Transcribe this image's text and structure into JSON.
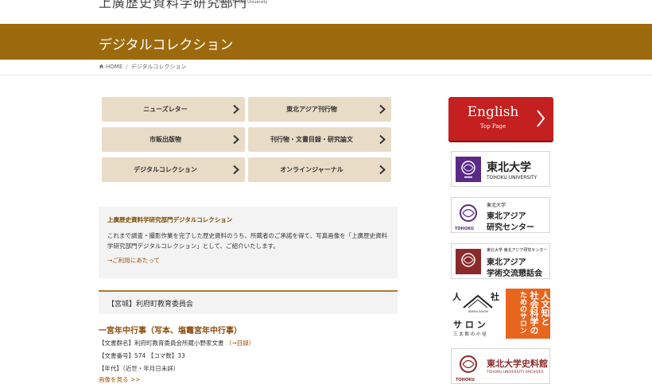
{
  "header": {
    "site_title": "上廣歴史資料学研究部門",
    "site_sub": "CNEAS, Tohoku University"
  },
  "banner": {
    "title": "デジタルコレクション"
  },
  "breadcrumb": {
    "home": "HOME",
    "current": "デジタルコレクション"
  },
  "nav": [
    {
      "label": "ニューズレター"
    },
    {
      "label": "東北アジア刊行物"
    },
    {
      "label": "市販出版物"
    },
    {
      "label": "刊行物・文書目録・研究論文"
    },
    {
      "label": "デジタルコレクション"
    },
    {
      "label": "オンラインジャーナル"
    }
  ],
  "info": {
    "title": "上廣歴史資料学研究部門デジタルコレクション",
    "text": "これまで調査・撮影作業を完了した歴史資料のうち、所蔵者のご承諾を得て、写真画像を「上廣歴史資料学研究部門デジタルコレクション」として、ご紹介いたします。",
    "link": "→ご利用にあたって"
  },
  "section": {
    "title": "【宮城】利府町教育委員会"
  },
  "item": {
    "title": "一宮年中行事（写本、塩竈宮年中行事）",
    "doc_group": "【文書群名】利府町教育委員会所蔵小野家文書",
    "doc_group_link": "（→目録）",
    "doc_number": "【文書番号】574 【コマ数】33",
    "era": "【年代】（近世・年月日未詳）",
    "more": "画像を見る >>"
  },
  "sidebar": {
    "english": {
      "main": "English",
      "sub": "Top Page"
    },
    "logos": [
      {
        "line1": "東北大学",
        "line2": "TOHOKU UNIVERSITY"
      },
      {
        "line1": "東北大学",
        "line2": "東北アジア",
        "line3": "研究センター",
        "foot": "TOHOKU"
      },
      {
        "line1": "東北大学 東北アジア研究センター",
        "line2": "東北アジア",
        "line3": "学術交流懇話会"
      },
      {
        "left_top": "人",
        "left_top2": "社",
        "left_mid": "JINSHA SALON",
        "left_main": "サ ロ ン",
        "left_foot": "三 太 郎 の 小 径",
        "right_col1": "人文知と",
        "right_col2": "社会科学の",
        "right_col3": "ためのサロン"
      },
      {
        "line1": "東北大学史料館",
        "line2": "TOHOKU UNIVERSITY ARCHIVES",
        "foot": "TOHOKU"
      }
    ]
  },
  "colors": {
    "banner": "#9c6a0d",
    "nav_bg": "#e8dcc7",
    "english": "#c42020",
    "accent": "#a0520a",
    "salon": "#e8651d",
    "tohoku_purple": "#5b2a86",
    "maroon": "#8a2a2a"
  }
}
